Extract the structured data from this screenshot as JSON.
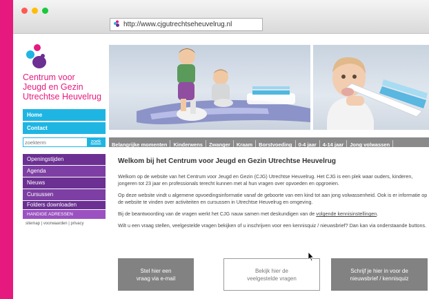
{
  "browser": {
    "url": "http://www.cjgutrechtseheuvelrug.nl",
    "dots": [
      "#ff5a52",
      "#ffbe05",
      "#18c93a"
    ]
  },
  "logo": {
    "line1": "Centrum voor",
    "line2": "Jeugd en Gezin",
    "line3": "Utrechtse Heuvelrug",
    "color": "#e6197f"
  },
  "nav_blue": [
    {
      "label": "Home"
    },
    {
      "label": "Contact"
    }
  ],
  "search": {
    "placeholder": "zoekterm",
    "button": "zoek"
  },
  "nav_purple": [
    {
      "label": "Openingstijden"
    },
    {
      "label": "Agenda"
    },
    {
      "label": "Nieuws"
    },
    {
      "label": "Cursussen"
    },
    {
      "label": "Folders downloaden"
    }
  ],
  "handige": "HANDIGE ADRESSEN",
  "footer_links": {
    "sitemap": "sitemap",
    "sep1": " | ",
    "voorwaarden": "voorwaarden",
    "sep2": " | ",
    "privacy": "privacy"
  },
  "tabs": [
    "Belangrijke momenten",
    "Kinderwens",
    "Zwanger",
    "Kraam",
    "Borstvoeding",
    "0-4 jaar",
    "4-14 jaar",
    "Jong volwassen"
  ],
  "content": {
    "title": "Welkom bij het Centrum voor Jeugd en Gezin Utrechtse Heuvelrug",
    "p1": "Welkom op de website van het Centrum voor Jeugd en Gezin (CJG) Utrechtse Heuvelrug. Het CJG is een plek waar ouders, kinderen, jongeren tot 23 jaar en professionals terecht kunnen met al hun vragen over opvoeden en opgroeien.",
    "p2": "Op deze website vindt u algemene opvoedingsinformatie vanaf de geboorte van een kind tot aan jong volwassenheid. Ook is er informatie op de website te vinden over activiteiten en cursussen in Utrechtse Heuvelrug en omgeving.",
    "p3_pre": "Bij de beantwoording van de vragen werkt het CJG nauw samen met deskundigen van de ",
    "p3_link": "volgende kennisinstellingen",
    "p3_post": ".",
    "p4": "Wilt u een vraag stellen, veelgestelde vragen bekijken of u inschrijven voor een kennisquiz / nieuwsbrief? Dan kan via onderstaande buttons."
  },
  "cta": {
    "email_l1": "Stel hier een",
    "email_l2": "vraag via e-mail",
    "faq_l1": "Bekijk hier de",
    "faq_l2": "veelgestelde vragen",
    "news_l1": "Schrijf je hier in voor de",
    "news_l2": "nieuwsbrief / kennisquiz"
  },
  "colors": {
    "pink": "#e6197f",
    "blue": "#1fb5e3",
    "purple": "#6b3092",
    "tab_grey": "#8a8a8a"
  }
}
